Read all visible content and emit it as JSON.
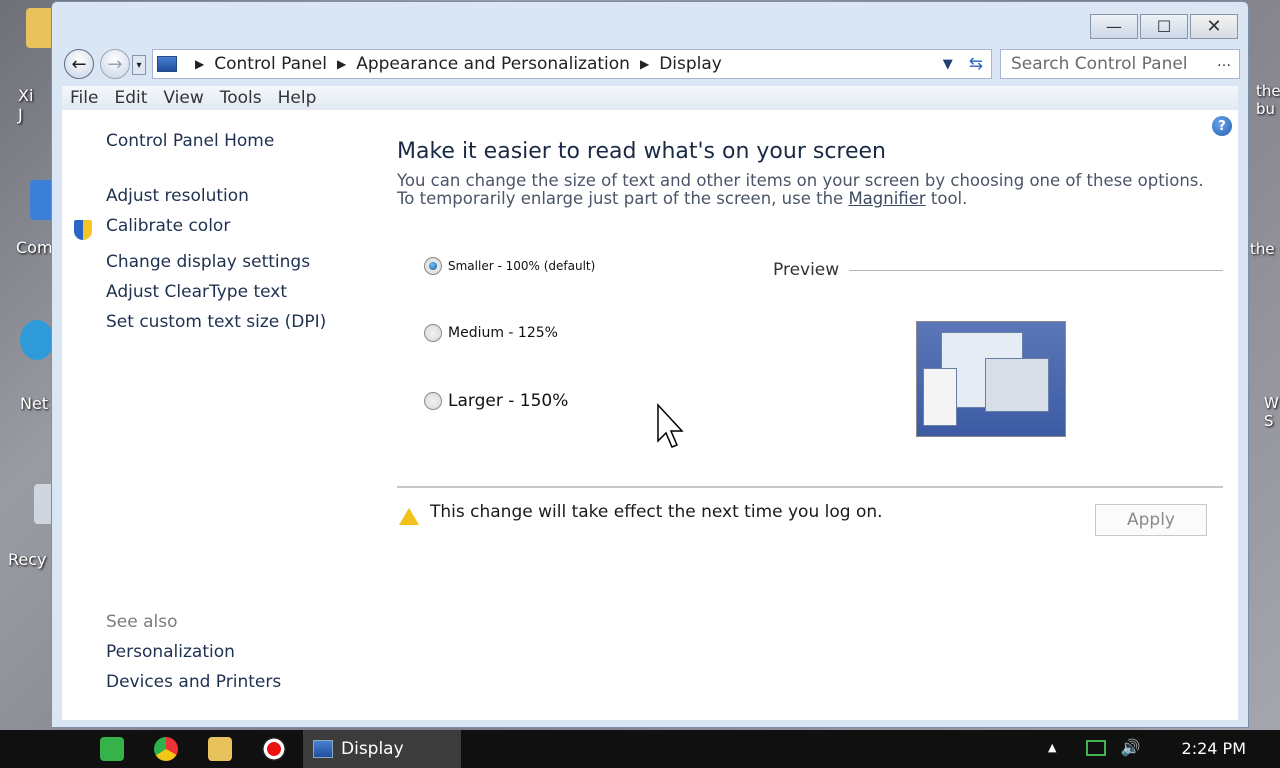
{
  "window": {
    "controls": {
      "minimize": "—",
      "maximize": "☐",
      "close": "✕"
    }
  },
  "nav": {
    "back": "←",
    "forward": "→",
    "crumbs": [
      "Control Panel",
      "Appearance and Personalization",
      "Display"
    ],
    "search_placeholder": "Search Control Panel",
    "search_more": "…"
  },
  "menu": {
    "items": [
      "File",
      "Edit",
      "View",
      "Tools",
      "Help"
    ]
  },
  "sidebar": {
    "home": "Control Panel Home",
    "links": [
      "Adjust resolution",
      "Calibrate color",
      "Change display settings",
      "Adjust ClearType text",
      "Set custom text size (DPI)"
    ],
    "see_also_label": "See also",
    "see_also": [
      "Personalization",
      "Devices and Printers"
    ]
  },
  "main": {
    "title": "Make it easier to read what's on your screen",
    "subtitle_line1": "You can change the size of text and other items on your screen by choosing one of these options.",
    "subtitle_line2_prefix": "To temporarily enlarge just part of the screen, use the",
    "subtitle_link": "Magnifier",
    "subtitle_line2_suffix": "tool.",
    "options": [
      {
        "label": "Smaller - 100% (default)",
        "checked": true
      },
      {
        "label": "Medium - 125%",
        "checked": false
      },
      {
        "label": "Larger - 150%",
        "checked": false
      }
    ],
    "preview_label": "Preview",
    "warning": "This change will take effect the next time you log on.",
    "apply_label": "Apply",
    "help": "?"
  },
  "desktop_icons": [
    "Xi J",
    "Com",
    "Net",
    "Recy",
    "the bu",
    "the",
    "W S"
  ],
  "taskbar": {
    "active_label": "Display",
    "time": "2:24 PM",
    "tray_arrow": "▲"
  },
  "colors": {
    "accent": "#1f5fb4",
    "window_frame": "#dbe6f4"
  }
}
